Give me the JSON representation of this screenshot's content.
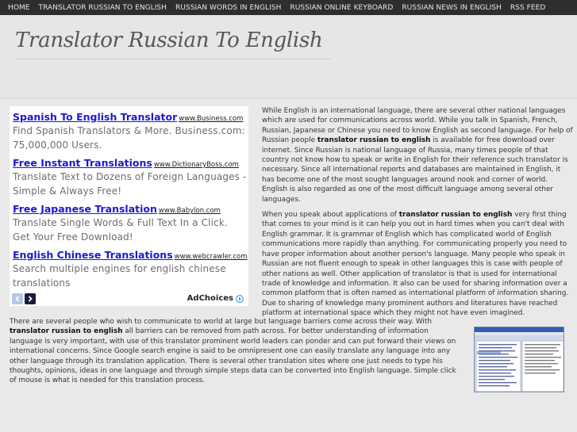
{
  "nav": {
    "items": [
      {
        "label": "HOME"
      },
      {
        "label": "TRANSLATOR RUSSIAN TO ENGLISH"
      },
      {
        "label": "RUSSIAN WORDS IN ENGLISH"
      },
      {
        "label": "RUSSIAN ONLINE KEYBOARD"
      },
      {
        "label": "RUSSIAN NEWS IN ENGLISH"
      },
      {
        "label": "RSS FEED"
      }
    ]
  },
  "header": {
    "title": "Translator Russian To English"
  },
  "ads": {
    "items": [
      {
        "title": "Spanish To English Translator",
        "url": "www.Business.com",
        "desc": "Find Spanish Translators & More. Business.com: 75,000,000 Users."
      },
      {
        "title": "Free Instant Translations",
        "url": "www.DictionaryBoss.com",
        "desc": "Translate Text to Dozens of Foreign Languages - Simple & Always Free!"
      },
      {
        "title": "Free Japanese Translation",
        "url": "www.Babylon.com",
        "desc": "Translate Single Words & Full Text In a Click. Get Your Free Download!"
      },
      {
        "title": "English Chinese Translations",
        "url": "www.webcrawler.com",
        "desc": "Search multiple engines for english chinese translations"
      }
    ],
    "adchoices": "AdChoices"
  },
  "article": {
    "p1_a": "While English is an international language, there are several other national languages which are used for communications across world. While you talk in Spanish, French, Russian, Japanese or Chinese you need to know English as second language. For help of Russian people ",
    "p1_b": "translator russian to english",
    "p1_c": " is available for free download over internet. Since Russian is national language of Russia, many times people of that country not know how to speak or write in English for their reference such translator is necessary. Since all international reports and databases are maintained in English, it has become one of the most sought languages around nook and corner of world. English is also regarded as one of the most difficult language among several other languages.",
    "p2_a": "When you speak about applications of ",
    "p2_b": "translator russian to english",
    "p2_c": " very first thing that comes to your mind is it can help you out in hard times when you can't deal with English grammar. It is grammar of English which has complicated world of English communications more rapidly than anything. For communicating properly you need to have proper information about another person's language. Many people who speak in Russian are not fluent enough to speak in other languages this is case with people of other nations as well. Other application of translator is that is used for international trade of knowledge and information. It also can be used for sharing information over a common platform that is often named as international platform of information sharing. Due to sharing of knowledge many prominent authors and literatures have reached platform at international space which they might not have even imagined.",
    "p3_a": "There are several people who wish to communicate to world at large but language barriers come across their way. With ",
    "p3_b": "translator russian to english",
    "p3_c": " all barriers can be removed from path across. For better understanding of information language is very important, with use of this translator prominent world leaders can ponder and can put forward their views on international concerns. Since Google search engine is said to be omnipresent one can easily translate any language into any other language through its translation application. There is several other translation sites where one just needs to type his thoughts, opinions, ideas in one language and through simple steps data can be converted into English language. Simple click of mouse is what is needed for this translation process."
  },
  "colors": {
    "nav_bg": "#2e2e2e",
    "page_bg": "#e9e9e9",
    "ad_link": "#1a1ad0"
  }
}
